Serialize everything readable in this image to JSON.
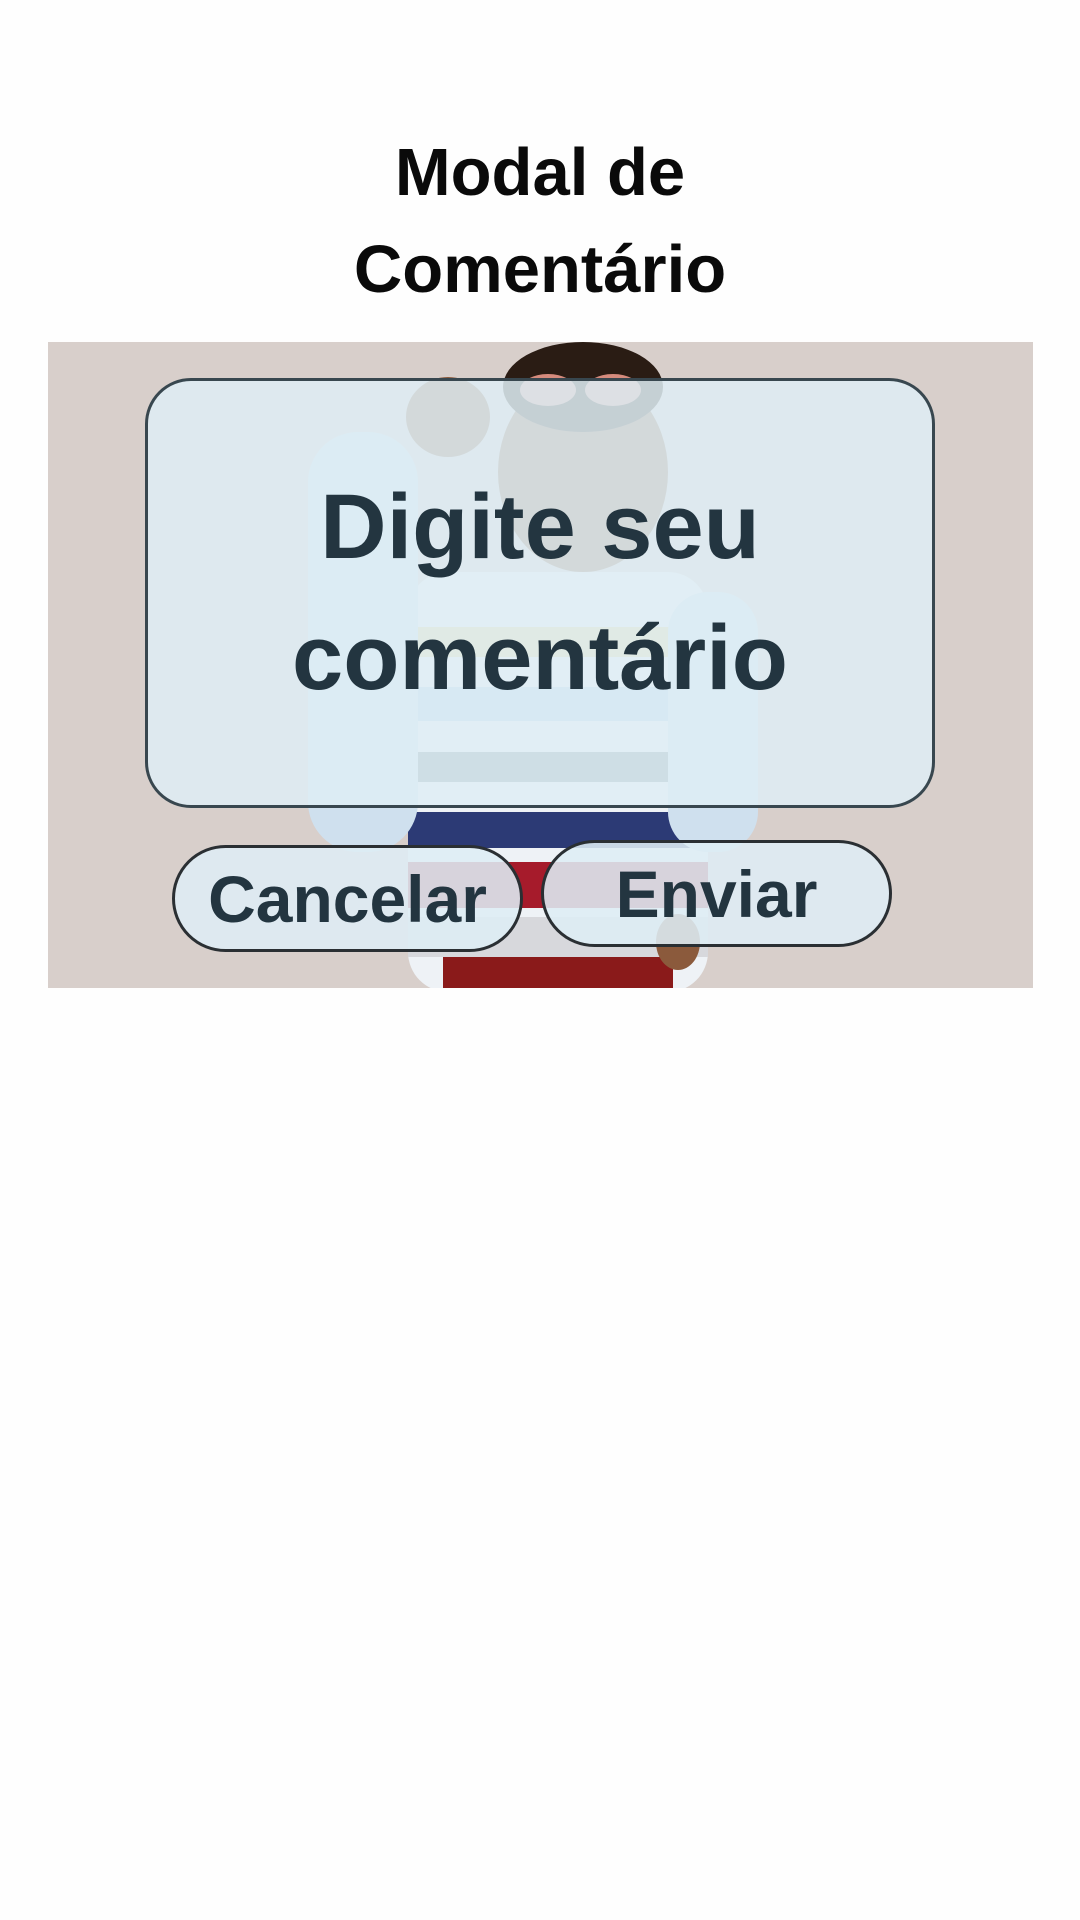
{
  "page": {
    "title_line1": "Modal de",
    "title_line2": "Comentário"
  },
  "modal": {
    "comment_placeholder_line1": "Digite seu",
    "comment_placeholder_line2": "comentário",
    "cancel_label": "Cancelar",
    "send_label": "Enviar"
  },
  "background_image": {
    "subject": "child-in-striped-sweater-with-sunglasses-photo"
  },
  "colors": {
    "text_dark": "#233540",
    "box_fill": "#deedf5",
    "box_border": "#38474f",
    "page_bg": "#fefefe"
  }
}
